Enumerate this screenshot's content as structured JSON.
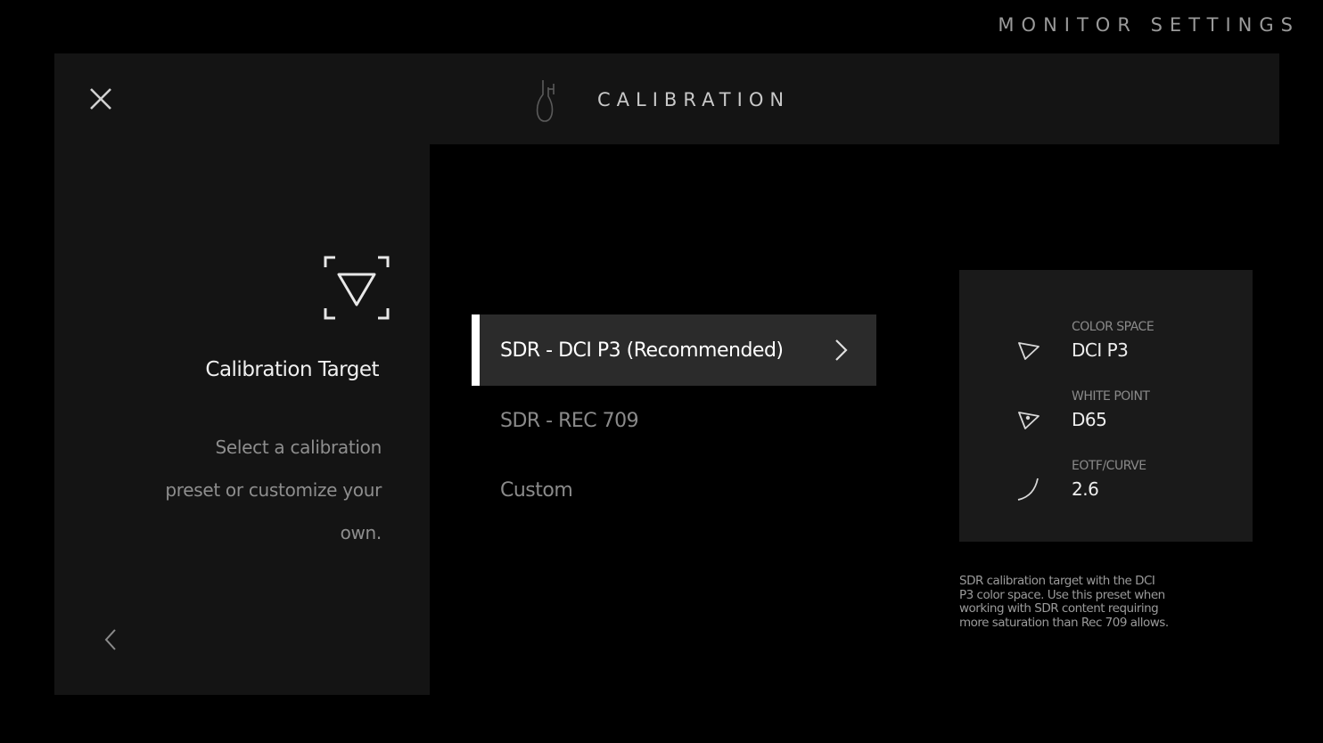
{
  "page": {
    "title": "MONITOR SETTINGS"
  },
  "header": {
    "label": "CALIBRATION",
    "icon": "calibration-probe-icon",
    "close_icon": "close-icon"
  },
  "left_panel": {
    "icon": "calibration-target-icon",
    "title": "Calibration Target",
    "description_lines": [
      "Select a calibration",
      "preset or customize your",
      "own."
    ],
    "back_icon": "chevron-left-icon"
  },
  "options": [
    {
      "label": "SDR - DCI P3 (Recommended)",
      "selected": true
    },
    {
      "label": "SDR - REC 709",
      "selected": false
    },
    {
      "label": "Custom",
      "selected": false
    }
  ],
  "info_card": {
    "rows": [
      {
        "label": "COLOR SPACE",
        "value": "DCI P3",
        "icon": "color-space-triangle-icon"
      },
      {
        "label": "WHITE POINT",
        "value": "D65",
        "icon": "white-point-triangle-icon"
      },
      {
        "label": "EOTF/CURVE",
        "value": "2.6",
        "icon": "curve-icon"
      }
    ]
  },
  "preset_description_lines": [
    "SDR calibration target with the DCI",
    "P3 color space. Use this preset when",
    "working with SDR content requiring",
    "more saturation than Rec 709 allows."
  ],
  "colors": {
    "background": "#000000",
    "panel": "#141414",
    "selected_row": "#2b2b2b",
    "accent": "#ffffff"
  }
}
